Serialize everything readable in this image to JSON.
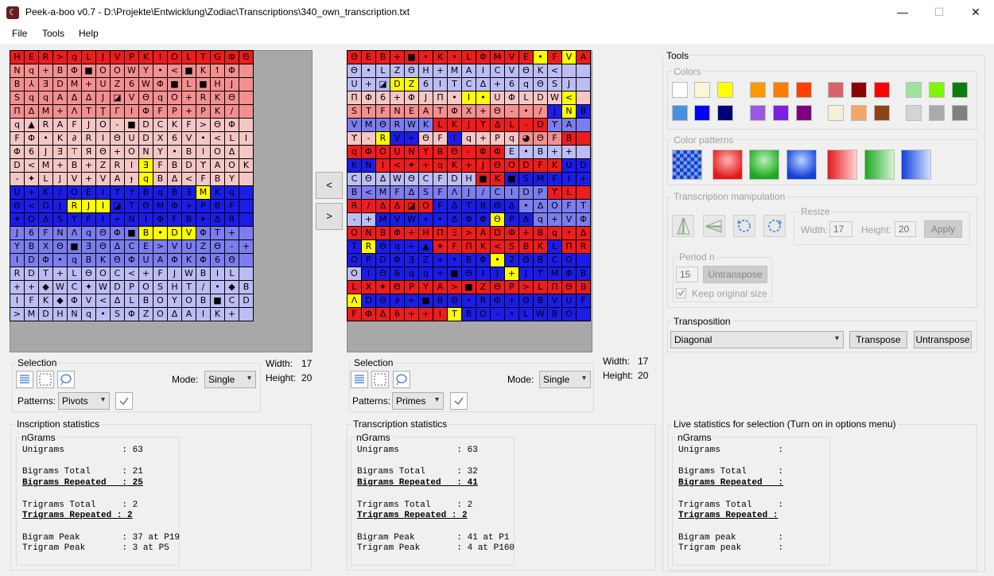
{
  "window": {
    "title": "Peek-a-boo v0.7 - D:\\Projekte\\Entwicklung\\Zodiac\\Transcriptions\\340_own_transcription.txt",
    "minimize": "—",
    "maximize": "☐",
    "close": "✕"
  },
  "menu": {
    "file": "File",
    "tools": "Tools",
    "help": "Help"
  },
  "palette": {
    "R": "#ee1c1c",
    "r": "#f48f8f",
    "p": "#f5c6c6",
    "B": "#1c1ce8",
    "b": "#7d7def",
    "l": "#bdbdf5",
    "Y": "#ffff00",
    "w": "#ffffff"
  },
  "inscription": {
    "symbols": [
      "HER>qLJVPKIOLTGΦΘ",
      "Nq+BΦ■OOWY•<■K↿Φ",
      "B⅄ƎDM+UZ6WΦ■L■HJ",
      "SqqAΔ∆J◪VΘqO+RKΘ",
      "ΠΔM+ΛTŢΓIΦFP+PK/",
      "q▲RAFJO-■DCKF>ΘΦ",
      "FΦ•K∂RIΘUDX6V•<LI",
      "Φ6JƎ⊤ЯΘ+OΝY•BlOΔ",
      "D<M+B+ZRIƎFBDϒAOK",
      "-✦LJV+VAɟqBΔ<FBY",
      "U+K/OEIϒYBqBƎMKq",
      "Θ<DJRJI◪TΘMΦ+PBF",
      "✦ΟΔSYFI+NIΦFB✦ΔR",
      "J6FNΛqΘΦ■B•DVΦT+",
      "YBXΘ■ƎΘΔCE>VUZΘ-+",
      "IDΦ•qBKΘΦUAΦKΦ6Θ",
      "RDT+LΘOC<+FJWBIL",
      "++◆WC✦WDPOSHT/•◆B",
      "IFK◆ΦV<ΔLBOYOB■CD",
      ">MDHNq•SΦZOΔAIK+"
    ],
    "colors": [
      "RRRRRRRRRRRRRRRRR",
      "rrrrrrrrrrrrrrrrr",
      "rrrrrrrrrrrrrrrrr",
      "rrrrrrrrrrrrrrrrr",
      "rrrrrrrrrrrrrrrrr",
      "ppppppppppppppppp",
      "ppppppppppppppppp",
      "ppppppppppppppppp",
      "pppppppppYppppppp",
      "pppppppppYppppppp",
      "BBBBBBBBBBBBBYBBB",
      "BBBBYYYBBBBBBBBBB",
      "BBBBBBBBBBBBBBBBB",
      "bbbbbbbbbYYYYbbbb",
      "bbbbbbbbbbbbbbbbb",
      "bbbbbbbbbbbbbbbbb",
      "lllllllllllllllll",
      "lllllllllllllllll",
      "lllllllllllllllll",
      "lllllllllllllllll"
    ]
  },
  "transcription": {
    "symbols": [
      "ΘEB+■•K•LΦMVE•FVA",
      "Θ•LZΘH+MAICVΘK<",
      "U+◪DZ6ITCΔ+6qΘSJ",
      "ΠΦ6+ΦJΠ•I•UΦLDW<",
      "STFNEATΦX+Θ-•/JNB",
      "VMΘRWKLKJϒΔL-DϒA",
      "ϒ-RV+ΘFIq+Pq◕ΘFB",
      "qΦOUNYBΘ-ΦΦE•B++",
      "KNI<✦+qK+JΘODFKUDY",
      "CΘΔWΘCFDH■K■SMFI+",
      "B<MFΔSFΛJ/CIDPϒL",
      "R/ΔΔ◪OFΔTBΘΔ•ΔOFT",
      "-+MVW+•ΔΦΦΘPΔq+VΦB",
      "ONBΦ+HΠΞ>ADΦ+Bq•ΔK",
      "TRΘq+▲✦FΠK<SBKLΠR",
      "OPDΦƎZ+•BΦ•2ΘBCO",
      "OIΘ6qq+■ΘIJ+JϒMΦB",
      "LX✦ΘPYA>■ZΘP>LΠΘB",
      "ΛDΘ∂+■BΘ•RΦ+ΘBVUF",
      "FΦΔ6++ITBO-•LWBO"
    ],
    "colors": [
      "RRRRRRRRRRRRRYRYR",
      "lllllllllllllllll",
      "lllYYllllllllllll",
      "ppppppppYYpppppYp",
      "rrrrrrrrrrrrrrBYB",
      "bbbbbbRRRRRRRRbbb",
      "ppYBBppBpppprrrRR",
      "RRRRRRRRRRRlllll",
      "BBRRRRRRRRRRRRRBB",
      "lllllllllRRBBBBBB",
      "bbbbbbbbbbbbbbRRR",
      "RRRRRRBBBBBBbbbbb",
      "llBBBBBBBBYBBbbbb",
      "RRRRRRRRRRRRRRRRR",
      "BYBBBBRRRRRRRRBRR",
      "BBBBBBBBBBYBBBBB",
      "lBBBBBBBBBBYBBBB",
      "RRRRRRRRRRRRRRRRR",
      "YBBBBBBBBBBBBBBBB",
      "RRRRRRRYBBBBBBBB"
    ]
  },
  "nav": {
    "left": "<",
    "right": ">"
  },
  "left_selection": {
    "label": "Selection",
    "mode_label": "Mode:",
    "mode": "Single",
    "patterns_label": "Patterns:",
    "pattern": "Pivots",
    "width_label": "Width:",
    "width": "17",
    "height_label": "Height:",
    "height": "20"
  },
  "right_selection": {
    "label": "Selection",
    "mode_label": "Mode:",
    "mode": "Single",
    "patterns_label": "Patterns:",
    "pattern": "Primes",
    "width_label": "Width:",
    "width": "17",
    "height_label": "Height:",
    "height": "20"
  },
  "tools": {
    "label": "Tools",
    "colors_label": "Colors",
    "swatches": [
      [
        "#ffffff",
        "#fbf6d5",
        "#ffff00",
        "#ff9900",
        "#ff7d00",
        "#ff4000",
        "#d9626b",
        "#8b0000",
        "#ff0000",
        "#9be59b",
        "#7ff500",
        "#0b7d0b"
      ],
      [
        "#4a90e2",
        "#0000ff",
        "#00007d",
        "#9b59e0",
        "#7d20e0",
        "#7d007d",
        "#f5f0d8",
        "#f5a565",
        "#8b4513",
        "#d4d4d4",
        "#aaaaaa",
        "#808080"
      ]
    ],
    "color_patterns_label": "Color patterns",
    "manip_label": "Transcription manipulation",
    "resize_label": "Resize",
    "width_label": "Width:",
    "width": "17",
    "height_label": "Height:",
    "height": "20",
    "apply": "Apply",
    "period_label": "Period n",
    "period": "15",
    "untranspose": "Untranspose",
    "keep_size": "Keep original size"
  },
  "transposition": {
    "label": "Transposition",
    "method": "Diagonal",
    "transpose": "Transpose",
    "untranspose": "Untranspose"
  },
  "stats_left": {
    "title": "Inscription statistics",
    "ngrams": "nGrams",
    "unigrams": "Unigrams           : 63",
    "bigrams_total": "Bigrams Total      : 21",
    "bigrams_repeated": "Bigrams Repeated   : 25",
    "trigrams_total": "Trigrams Total     : 2",
    "trigrams_repeated": "Trigrams Repeated : 2",
    "bigram_peak": "Bigram Peak        : 37 at P19",
    "trigram_peak": "Trigram Peak       : 3 at P5"
  },
  "stats_mid": {
    "title": "Transcription statistics",
    "ngrams": "nGrams",
    "unigrams": "Unigrams           : 63",
    "bigrams_total": "Bigrams Total      : 32",
    "bigrams_repeated": "Bigrams Repeated   : 41",
    "trigrams_total": "Trigrams Total     : 2",
    "trigrams_repeated": "Trigrams Repeated : 2",
    "bigram_peak": "Bigram Peak        : 41 at P1",
    "trigram_peak": "Trigram Peak       : 4 at P160"
  },
  "stats_right": {
    "title": "Live statistics for selection (Turn on in options menu)",
    "ngrams": "nGrams",
    "unigrams": "Unigrams           :",
    "bigrams_total": "Bigrams Total      :",
    "bigrams_repeated": "Bigrams Repeated   :",
    "trigrams_total": "Trigrams Total     :",
    "trigrams_repeated": "Trigrams Repeated :",
    "bigram_peak": "Bigram peak        :",
    "trigram_peak": "Trigram peak       :"
  }
}
